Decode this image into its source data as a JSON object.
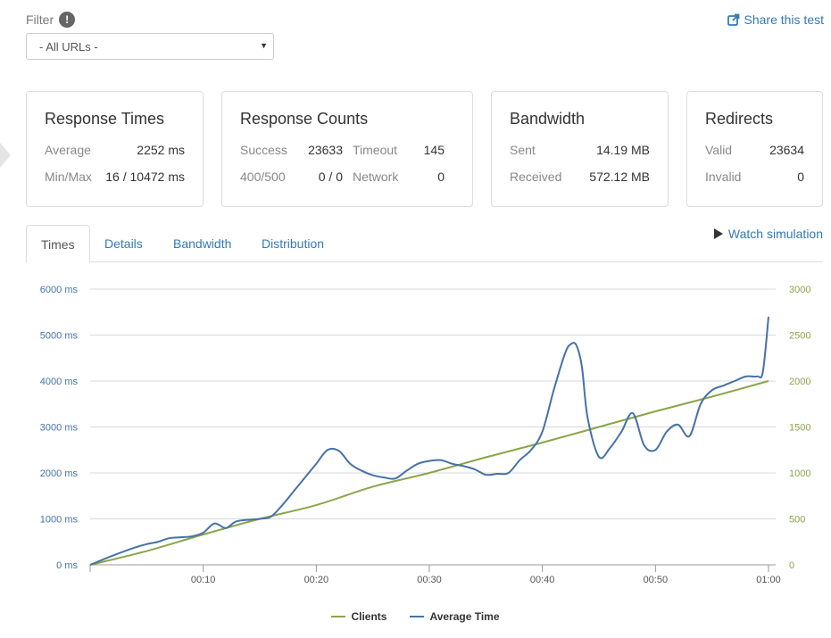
{
  "filter": {
    "label": "Filter",
    "selected": "- All URLs -"
  },
  "share_label": "Share this test",
  "cards": {
    "response_times": {
      "title": "Response Times",
      "average_label": "Average",
      "average_value": "2252 ms",
      "minmax_label": "Min/Max",
      "minmax_value": "16 / 10472 ms"
    },
    "response_counts": {
      "title": "Response Counts",
      "success_label": "Success",
      "success_value": "23633",
      "timeout_label": "Timeout",
      "timeout_value": "145",
      "errors_label": "400/500",
      "errors_value": "0 / 0",
      "network_label": "Network",
      "network_value": "0"
    },
    "bandwidth": {
      "title": "Bandwidth",
      "sent_label": "Sent",
      "sent_value": "14.19 MB",
      "received_label": "Received",
      "received_value": "572.12 MB"
    },
    "redirects": {
      "title": "Redirects",
      "valid_label": "Valid",
      "valid_value": "23634",
      "invalid_label": "Invalid",
      "invalid_value": "0"
    }
  },
  "tabs": [
    "Times",
    "Details",
    "Bandwidth",
    "Distribution"
  ],
  "watch_label": "Watch simulation",
  "colors": {
    "clients": "#8aa54a",
    "avg_time": "#4572a7",
    "link": "#337ab7"
  },
  "chart_data": {
    "type": "line",
    "y_left": {
      "ticks": [
        "0 ms",
        "1000 ms",
        "2000 ms",
        "3000 ms",
        "4000 ms",
        "5000 ms",
        "6000 ms"
      ],
      "range": [
        0,
        6000
      ]
    },
    "y_right": {
      "ticks": [
        "0",
        "500",
        "1000",
        "1500",
        "2000",
        "2500",
        "3000"
      ],
      "range": [
        0,
        3000
      ]
    },
    "x_ticks": [
      "00:10",
      "00:20",
      "00:30",
      "00:40",
      "00:50",
      "01:00"
    ],
    "x_range": [
      0,
      60
    ],
    "legend_position": "bottom",
    "series": [
      {
        "name": "Clients",
        "axis": "right",
        "x": [
          0,
          5,
          10,
          15,
          20,
          25,
          30,
          35,
          40,
          45,
          50,
          55,
          60
        ],
        "values": [
          0,
          150,
          330,
          500,
          650,
          850,
          1000,
          1170,
          1330,
          1500,
          1670,
          1830,
          2000
        ]
      },
      {
        "name": "Average Time",
        "axis": "left",
        "x": [
          0,
          2,
          4,
          5,
          6,
          7,
          8,
          9,
          10,
          11,
          12,
          13,
          15,
          16,
          17,
          18,
          19,
          20,
          21,
          22,
          23,
          24,
          25,
          26,
          27,
          28,
          29,
          30,
          31,
          32,
          33,
          34,
          35,
          36,
          37,
          38,
          39,
          40,
          41,
          42,
          42.5,
          43,
          43.5,
          44,
          45,
          46,
          47,
          48,
          49,
          50,
          51,
          52,
          53,
          54,
          55,
          56,
          57,
          58,
          59,
          59.5,
          60
        ],
        "values": [
          0,
          200,
          380,
          450,
          500,
          580,
          600,
          620,
          700,
          900,
          800,
          950,
          1000,
          1050,
          1300,
          1600,
          1900,
          2200,
          2500,
          2480,
          2200,
          2050,
          1950,
          1900,
          1880,
          2050,
          2200,
          2260,
          2280,
          2200,
          2150,
          2080,
          1960,
          1980,
          2000,
          2280,
          2500,
          2900,
          3800,
          4600,
          4800,
          4780,
          4300,
          3200,
          2350,
          2550,
          2900,
          3300,
          2600,
          2500,
          2900,
          3050,
          2800,
          3500,
          3800,
          3900,
          4000,
          4100,
          4100,
          4200,
          5400
        ]
      }
    ]
  }
}
